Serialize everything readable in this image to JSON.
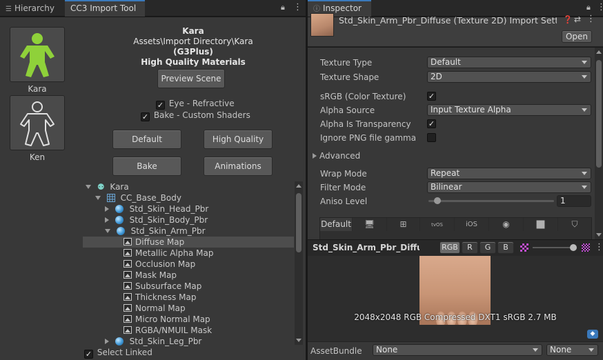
{
  "left_tabs": {
    "hierarchy": "Hierarchy",
    "import_tool": "CC3 Import Tool"
  },
  "characters": [
    {
      "name": "Kara",
      "icon": "humanoid-green-icon"
    },
    {
      "name": "Ken",
      "icon": "humanoid-outline-icon"
    }
  ],
  "import_info": {
    "name": "Kara",
    "path": "Assets\\Import Directory\\Kara",
    "generation": "(G3Plus)",
    "quality": "High Quality Materials"
  },
  "buttons": {
    "preview": "Preview Scene",
    "default": "Default",
    "high_quality": "High Quality",
    "bake": "Bake",
    "animations": "Animations"
  },
  "options": {
    "eye": {
      "label": "Eye - Refractive",
      "checked": true
    },
    "bake_shaders": {
      "label": "Bake - Custom Shaders",
      "checked": true
    }
  },
  "tree": {
    "root": "Kara",
    "body": "CC_Base_Body",
    "head": "Std_Skin_Head_Pbr",
    "skin_body": "Std_Skin_Body_Pbr",
    "arm": "Std_Skin_Arm_Pbr",
    "maps": [
      "Diffuse Map",
      "Metallic Alpha Map",
      "Occlusion Map",
      "Mask Map",
      "Subsurface Map",
      "Thickness Map",
      "Normal Map",
      "Micro Normal Map",
      "RGBA/NMUIL Mask"
    ],
    "leg": "Std_Skin_Leg_Pbr",
    "selected": "Diffuse Map"
  },
  "select_linked": {
    "label": "Select Linked",
    "checked": true
  },
  "inspector": {
    "tab": "Inspector",
    "title": "Std_Skin_Arm_Pbr_Diffuse (Texture 2D) Import Setti",
    "open": "Open",
    "fields": {
      "texture_type": {
        "label": "Texture Type",
        "value": "Default"
      },
      "texture_shape": {
        "label": "Texture Shape",
        "value": "2D"
      },
      "srgb": {
        "label": "sRGB (Color Texture)",
        "checked": true
      },
      "alpha_source": {
        "label": "Alpha Source",
        "value": "Input Texture Alpha"
      },
      "alpha_transparency": {
        "label": "Alpha Is Transparency",
        "checked": true
      },
      "ignore_png": {
        "label": "Ignore PNG file gamma",
        "checked": false
      },
      "advanced": "Advanced",
      "wrap_mode": {
        "label": "Wrap Mode",
        "value": "Repeat"
      },
      "filter_mode": {
        "label": "Filter Mode",
        "value": "Bilinear"
      },
      "aniso": {
        "label": "Aniso Level",
        "value": "1"
      }
    },
    "platform_tabs": [
      "Default",
      "monitor-icon",
      "windows-icon",
      "tvOS",
      "iOS",
      "webgl-icon",
      "android-icon",
      "html5-icon"
    ],
    "preview": {
      "name": "Std_Skin_Arm_Pbr_Diffuse",
      "channels": [
        "RGB",
        "R",
        "G",
        "B"
      ],
      "info": "2048x2048  RGB Compressed DXT1 sRGB   2.7 MB"
    },
    "asset_bundle": {
      "label": "AssetBundle",
      "value": "None",
      "variant": "None"
    }
  }
}
